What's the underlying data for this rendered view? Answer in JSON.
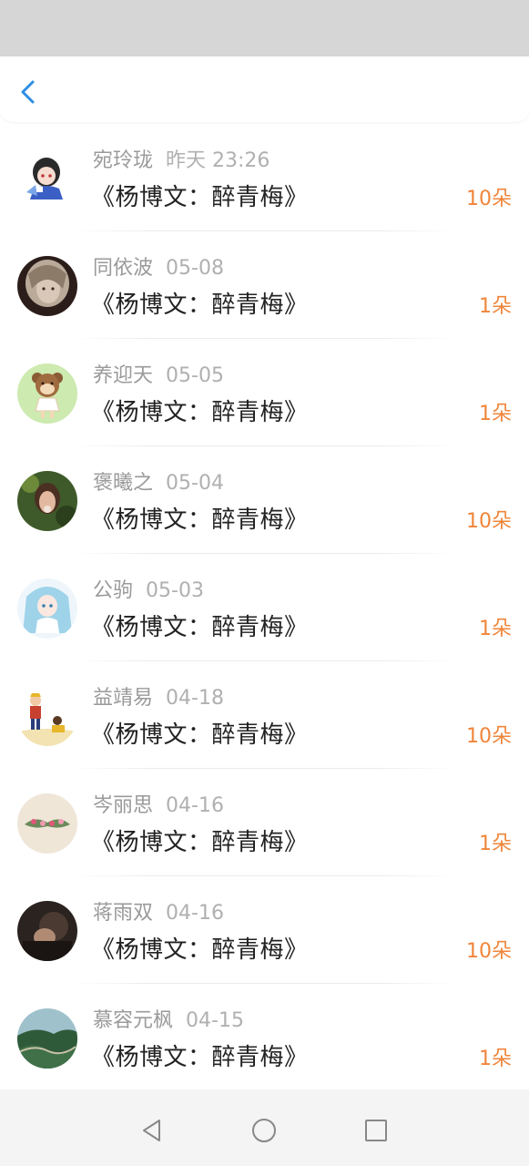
{
  "header": {
    "back_icon": "chevron-left-icon",
    "accent": "#2d8ee6"
  },
  "colors": {
    "count": "#f0853a",
    "status_bar": "#d6d6d6",
    "nav_bar": "#f4f4f4"
  },
  "gifts": [
    {
      "name": "宛玲珑",
      "time": "昨天 23:26",
      "title": "《杨博文：醉青梅》",
      "count": "10朵",
      "avatar": "anime-girl-avatar"
    },
    {
      "name": "同依波",
      "time": "05-08",
      "title": "《杨博文：醉青梅》",
      "count": "1朵",
      "avatar": "portrait-avatar"
    },
    {
      "name": "养迎天",
      "time": "05-05",
      "title": "《杨博文：醉青梅》",
      "count": "1朵",
      "avatar": "cartoon-bear-avatar"
    },
    {
      "name": "褒曦之",
      "time": "05-04",
      "title": "《杨博文：醉青梅》",
      "count": "10朵",
      "avatar": "photo-girl-avatar"
    },
    {
      "name": "公驹",
      "time": "05-03",
      "title": "《杨博文：醉青梅》",
      "count": "1朵",
      "avatar": "anime-blue-hair-avatar"
    },
    {
      "name": "益靖易",
      "time": "04-18",
      "title": "《杨博文：醉青梅》",
      "count": "10朵",
      "avatar": "cartoon-kids-avatar"
    },
    {
      "name": "岑丽思",
      "time": "04-16",
      "title": "《杨博文：醉青梅》",
      "count": "1朵",
      "avatar": "flower-mustache-avatar"
    },
    {
      "name": "蒋雨双",
      "time": "04-16",
      "title": "《杨博文：醉青梅》",
      "count": "10朵",
      "avatar": "dark-photo-avatar"
    },
    {
      "name": "慕容元枫",
      "time": "04-15",
      "title": "《杨博文：醉青梅》",
      "count": "1朵",
      "avatar": "great-wall-avatar"
    }
  ],
  "nav": {
    "back": "back-triangle-icon",
    "home": "home-circle-icon",
    "recent": "recent-square-icon"
  }
}
